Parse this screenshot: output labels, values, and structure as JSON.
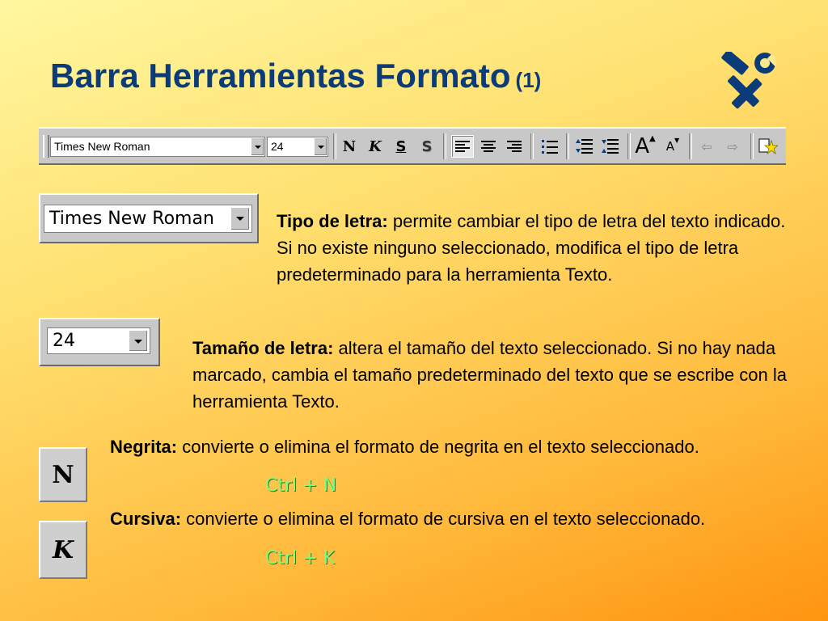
{
  "slide": {
    "title": "Barra Herramientas Formato",
    "title_suffix": "(1)",
    "title_color": "#0b3b78",
    "title_icon": "tools-icon"
  },
  "toolbar": {
    "font_value": "Times New Roman",
    "size_value": "24",
    "buttons": [
      {
        "name": "bold",
        "glyph": "N"
      },
      {
        "name": "italic",
        "glyph": "K"
      },
      {
        "name": "underline",
        "glyph": "S"
      },
      {
        "name": "shadow",
        "glyph": "S"
      },
      {
        "name": "align-left",
        "icon": "align-left-icon"
      },
      {
        "name": "align-center",
        "icon": "align-center-icon"
      },
      {
        "name": "align-right",
        "icon": "align-right-icon"
      },
      {
        "name": "bullets",
        "icon": "bullets-icon"
      },
      {
        "name": "increase-spacing",
        "icon": "increase-spacing-icon"
      },
      {
        "name": "decrease-spacing",
        "icon": "decrease-spacing-icon"
      },
      {
        "name": "increase-font",
        "glyph": "A"
      },
      {
        "name": "decrease-font",
        "glyph": "A"
      },
      {
        "name": "promote",
        "icon": "arrow-left-icon"
      },
      {
        "name": "demote",
        "icon": "arrow-right-icon"
      },
      {
        "name": "animation-effects",
        "icon": "star-icon"
      }
    ]
  },
  "font_type": {
    "combo_value": "Times New Roman",
    "label": "Tipo de letra:",
    "text": " permite cambiar el tipo de letra del texto indicado. Si no existe ninguno seleccionado, modifica el tipo de letra predeterminado para la herramienta Texto."
  },
  "font_size": {
    "combo_value": "24",
    "label": "Tamaño de letra:",
    "text": " altera el tamaño del texto seleccionado. Si no hay nada marcado, cambia el tamaño predeterminado del texto que se escribe con la herramienta Texto."
  },
  "bold": {
    "button_glyph": "N",
    "label": "Negrita:",
    "text": " convierte o elimina el formato de negrita en el texto seleccionado.",
    "shortcut": "Ctrl + N"
  },
  "italic": {
    "button_glyph": "K",
    "label": "Cursiva:",
    "text": " convierte o elimina el formato de cursiva en el texto seleccionado.",
    "shortcut": "Ctrl + K"
  },
  "colors": {
    "shortcut_text": "#7cff7c",
    "background_start": "#fff7a0",
    "background_end": "#ff9410"
  }
}
